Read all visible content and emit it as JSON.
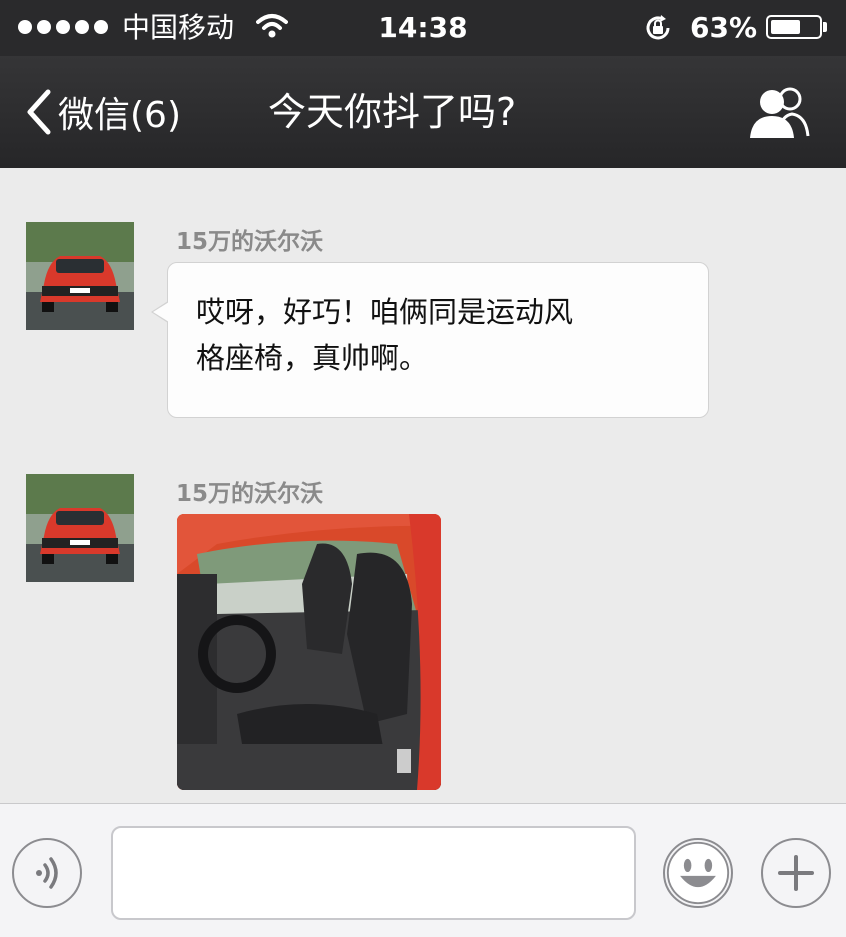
{
  "status_bar": {
    "carrier": "中国移动",
    "time": "14:38",
    "battery_percent": "63%",
    "battery_level": 0.63,
    "signal_dots": 5
  },
  "nav": {
    "back_label": "微信(6)",
    "title": "今天你抖了吗?"
  },
  "messages": [
    {
      "sender": "15万的沃尔沃",
      "type": "text",
      "lines": [
        "哎呀，好巧！咱俩同是运动风",
        "格座椅，真帅啊。"
      ]
    },
    {
      "sender": "15万的沃尔沃",
      "type": "image"
    }
  ],
  "input": {
    "placeholder": ""
  },
  "colors": {
    "nav_bg": "#2a2a2c",
    "chat_bg": "#ebebeb",
    "car_red": "#d9392b"
  }
}
